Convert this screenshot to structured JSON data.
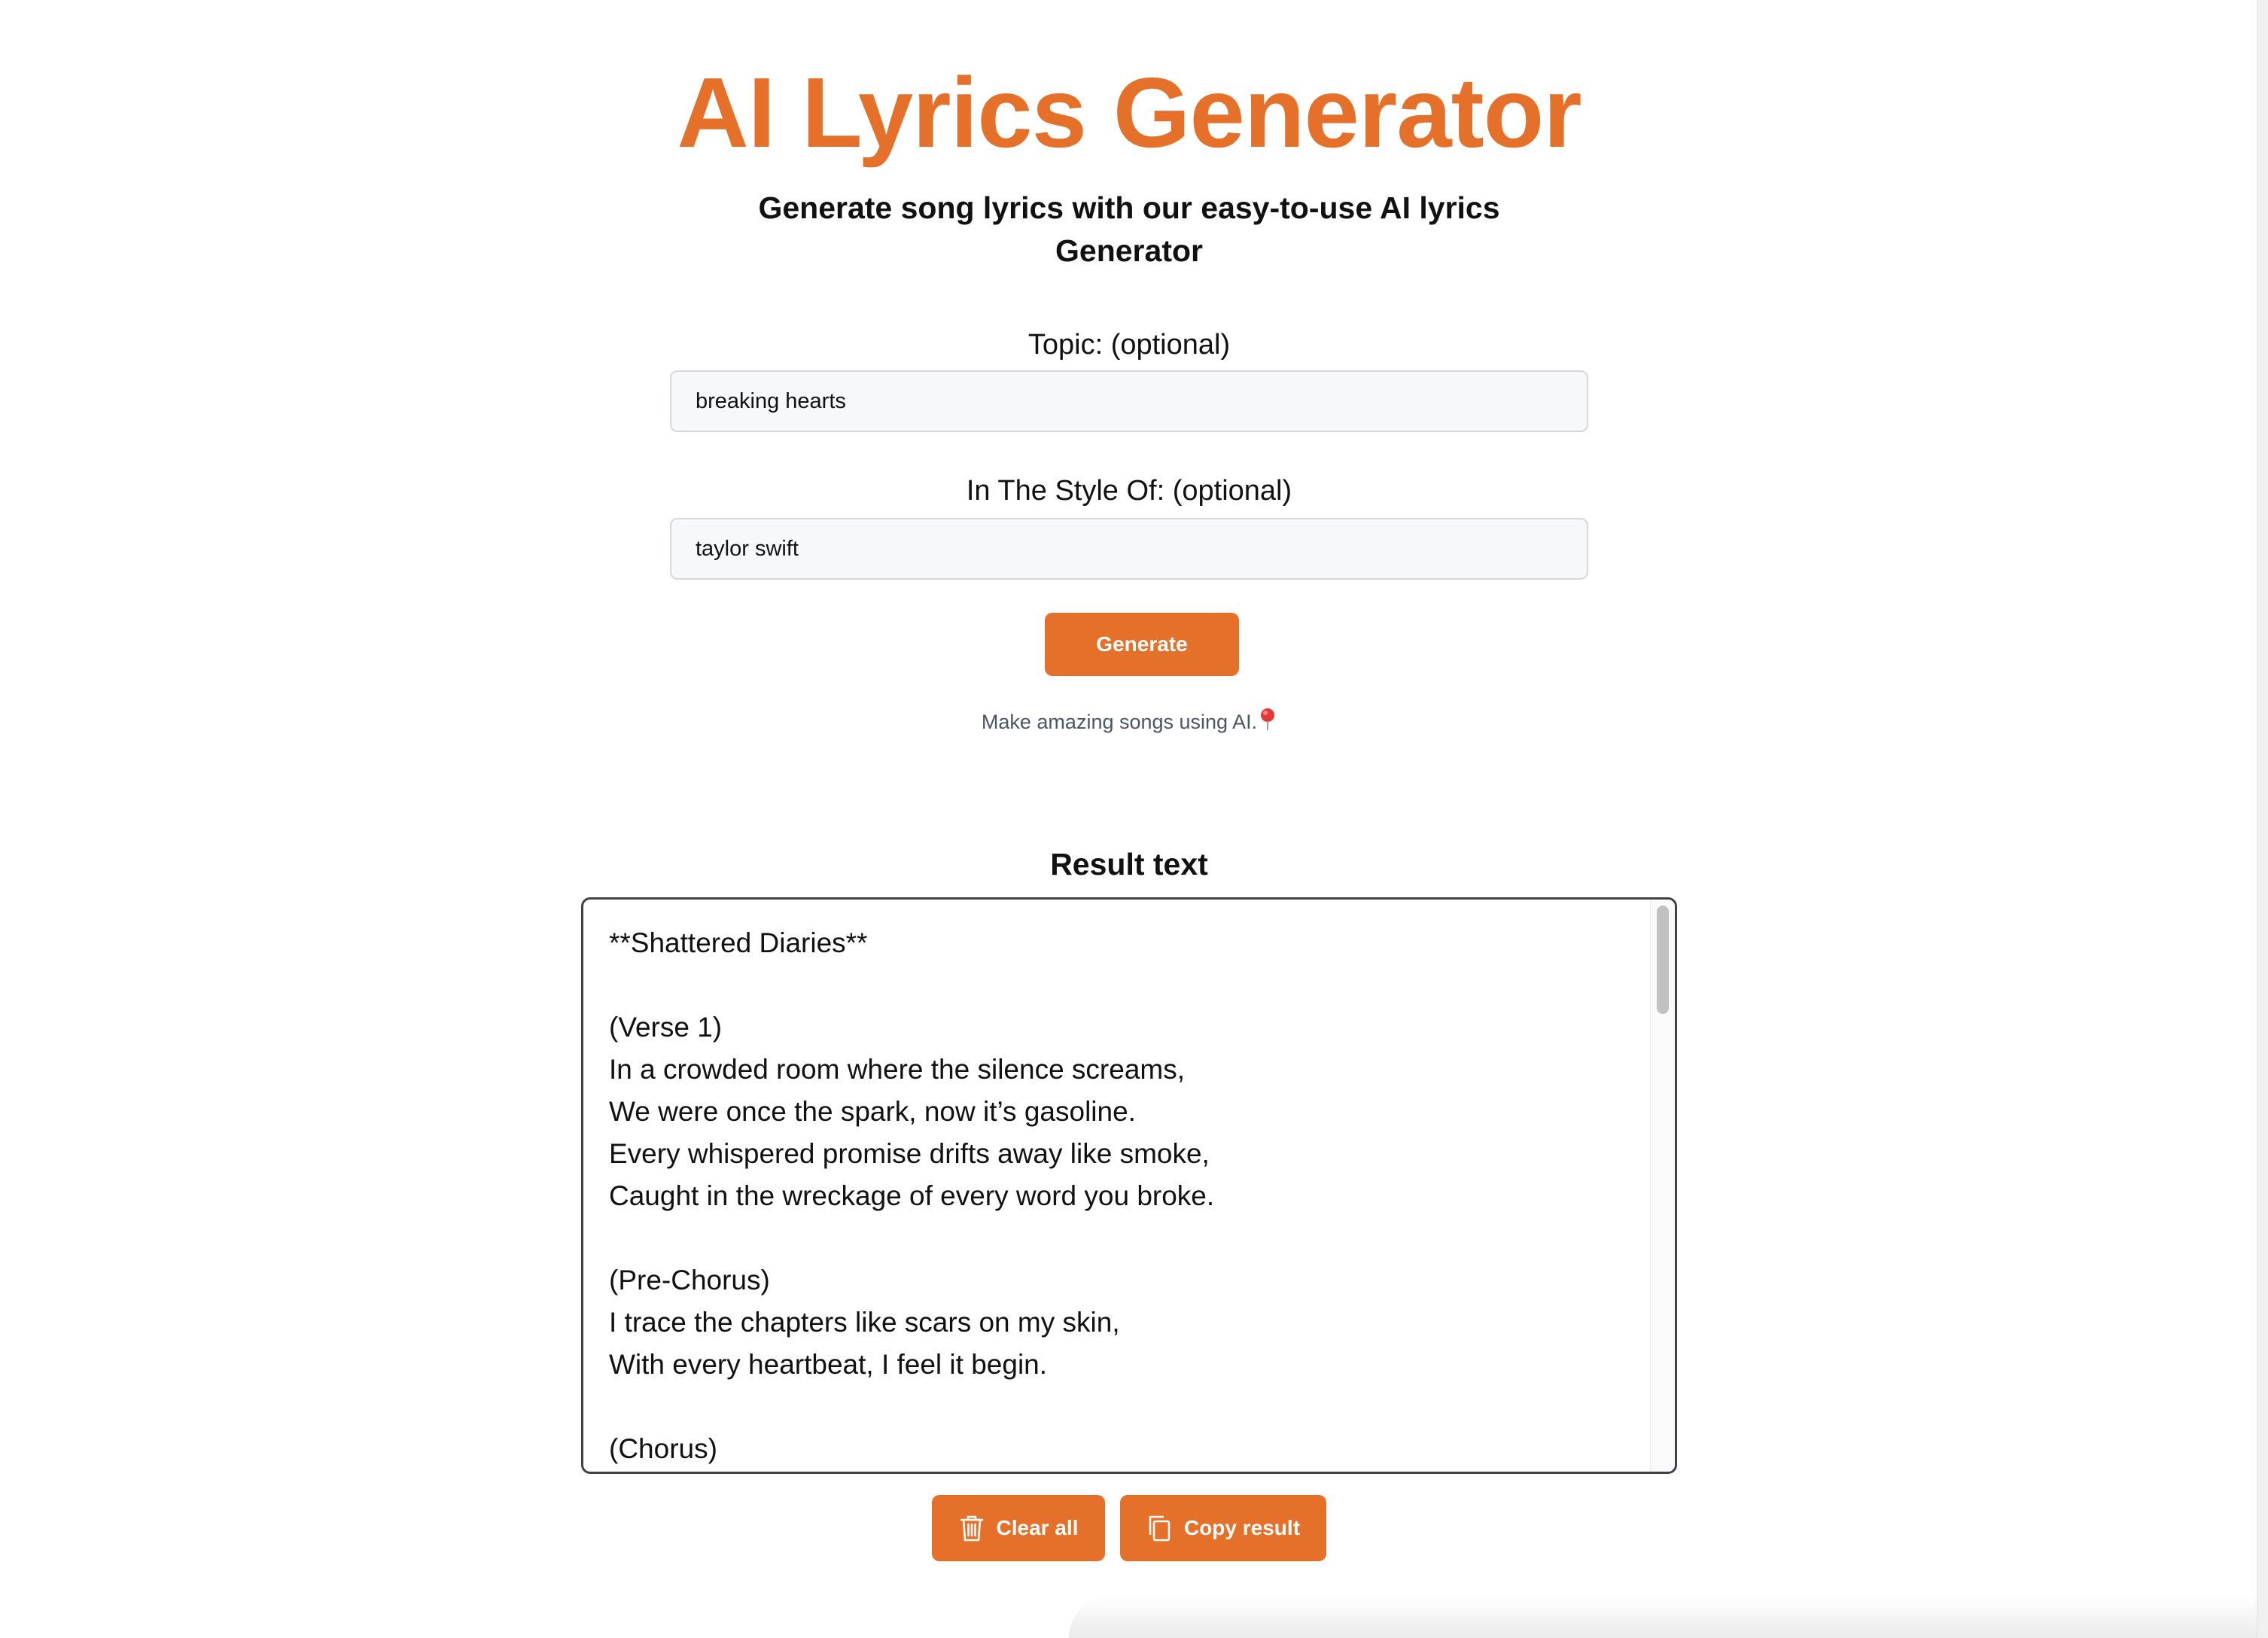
{
  "header": {
    "title": "AI Lyrics Generator",
    "subtitle": "Generate song lyrics with our easy-to-use AI lyrics Generator"
  },
  "form": {
    "topic": {
      "label": "Topic: (optional)",
      "value": "breaking hearts"
    },
    "style": {
      "label": "In The Style Of: (optional)",
      "value": "taylor swift"
    },
    "generate_label": "Generate",
    "tagline": "Make amazing songs using AI.",
    "tagline_icon": "pin-icon"
  },
  "result": {
    "title": "Result text",
    "lines": [
      "**Shattered Diaries**",
      "",
      "(Verse 1)",
      "In a crowded room where the silence screams,",
      "We were once the spark, now it’s gasoline.",
      "Every whispered promise drifts away like smoke,",
      "Caught in the wreckage of every word you broke.",
      "",
      "(Pre-Chorus)",
      "I trace the chapters like scars on my skin,",
      "With every heartbeat, I feel it begin.",
      "",
      "(Chorus)"
    ]
  },
  "actions": {
    "clear_label": "Clear all",
    "clear_icon": "trash-icon",
    "copy_label": "Copy result",
    "copy_icon": "copy-icon"
  },
  "colors": {
    "accent": "#e5702a",
    "text": "#111111",
    "muted": "#4b5563",
    "pin": "#e53935"
  }
}
